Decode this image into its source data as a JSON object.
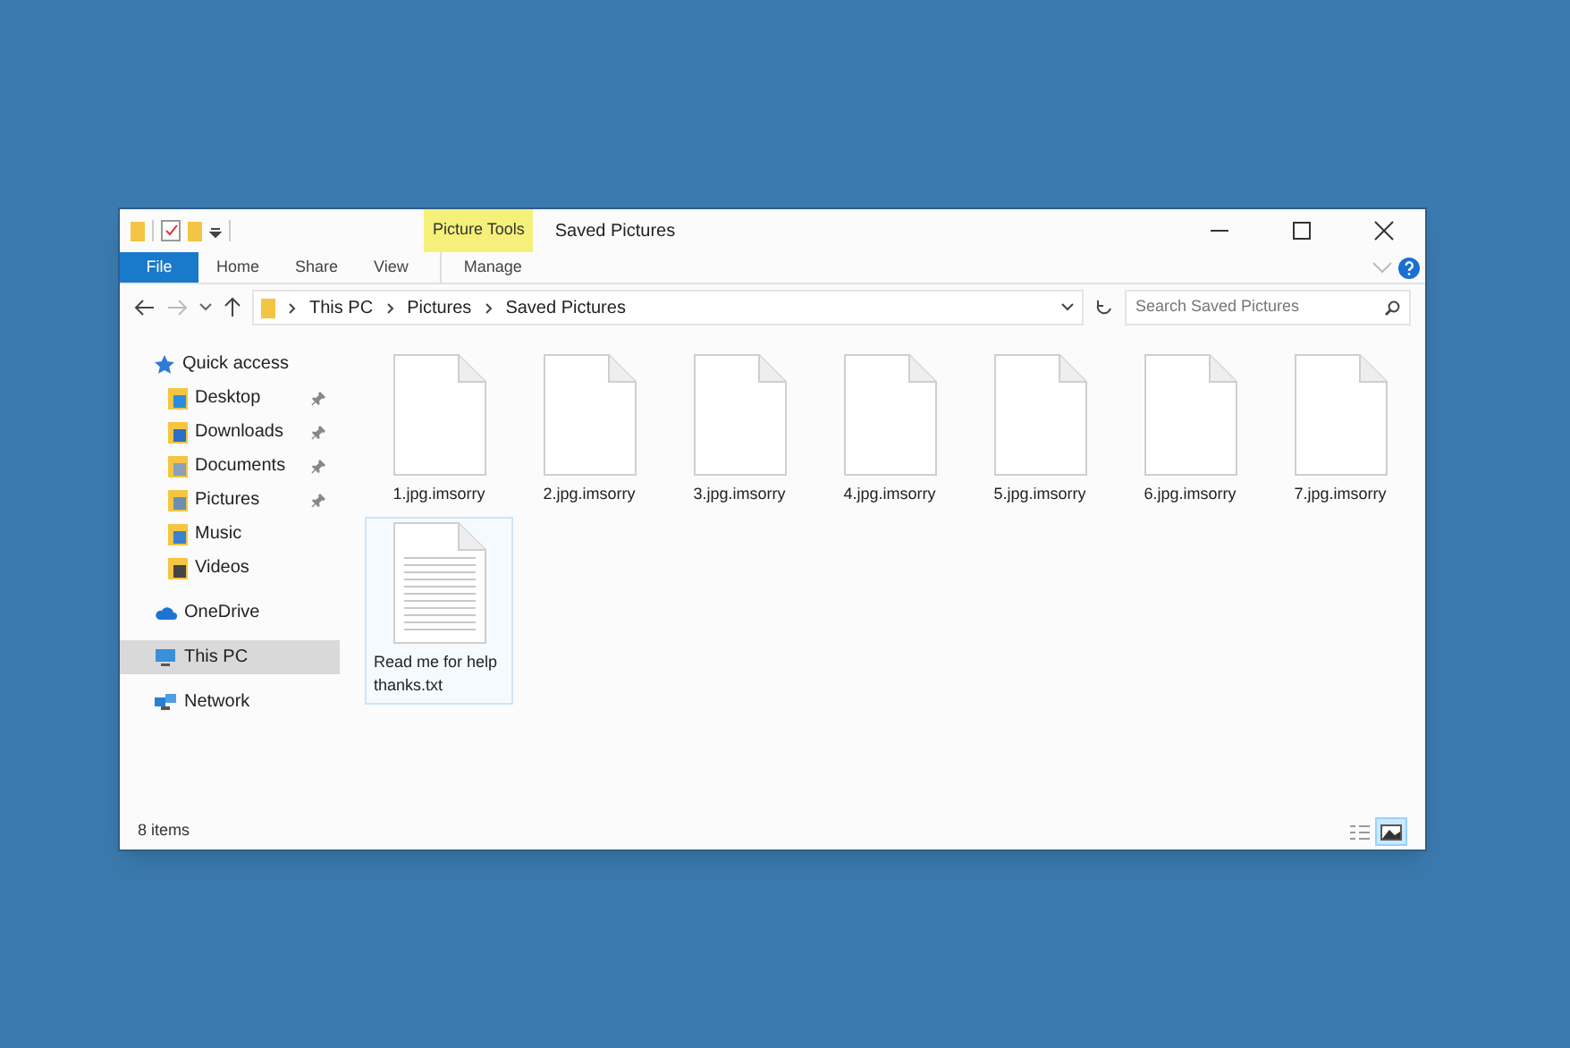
{
  "window": {
    "title": "Saved Pictures",
    "context_tab": "Picture Tools"
  },
  "ribbon": {
    "tabs": [
      {
        "label": "File",
        "kind": "file",
        "selected": false
      },
      {
        "label": "Home",
        "kind": "tab",
        "selected": false
      },
      {
        "label": "Share",
        "kind": "tab",
        "selected": false
      },
      {
        "label": "View",
        "kind": "tab",
        "selected": false
      },
      {
        "label": "Manage",
        "kind": "tab",
        "selected": false
      }
    ]
  },
  "address": {
    "path": [
      "This PC",
      "Pictures",
      "Saved Pictures"
    ],
    "search": {
      "placeholder": "Search Saved Pictures"
    }
  },
  "sidebar": {
    "items": [
      {
        "label": "Quick access",
        "kind": "star",
        "selected": false,
        "children": [
          {
            "label": "Desktop",
            "kind": "desktop",
            "pinned": true,
            "selected": false
          },
          {
            "label": "Downloads",
            "kind": "downloads",
            "pinned": true,
            "selected": false
          },
          {
            "label": "Documents",
            "kind": "documents",
            "pinned": true,
            "selected": false
          },
          {
            "label": "Pictures",
            "kind": "pictures",
            "pinned": true,
            "selected": false
          },
          {
            "label": "Music",
            "kind": "music",
            "pinned": false,
            "selected": false
          },
          {
            "label": "Videos",
            "kind": "videos",
            "pinned": false,
            "selected": false
          }
        ]
      },
      {
        "label": "OneDrive",
        "kind": "cloud",
        "selected": false
      },
      {
        "label": "This PC",
        "kind": "pc",
        "selected": true
      },
      {
        "label": "Network",
        "kind": "network",
        "selected": false
      }
    ]
  },
  "files": [
    {
      "name": "1.jpg.imsorry",
      "kind": "blank",
      "selected": false
    },
    {
      "name": "2.jpg.imsorry",
      "kind": "blank",
      "selected": false
    },
    {
      "name": "3.jpg.imsorry",
      "kind": "blank",
      "selected": false
    },
    {
      "name": "4.jpg.imsorry",
      "kind": "blank",
      "selected": false
    },
    {
      "name": "5.jpg.imsorry",
      "kind": "blank",
      "selected": false
    },
    {
      "name": "6.jpg.imsorry",
      "kind": "blank",
      "selected": false
    },
    {
      "name": "7.jpg.imsorry",
      "kind": "blank",
      "selected": false
    },
    {
      "name": "Read me for help thanks.txt",
      "kind": "text",
      "selected": true
    }
  ],
  "status_bar": {
    "count": "8 items",
    "views": [
      {
        "kind": "details",
        "selected": false
      },
      {
        "kind": "large-icons",
        "selected": true
      }
    ]
  }
}
